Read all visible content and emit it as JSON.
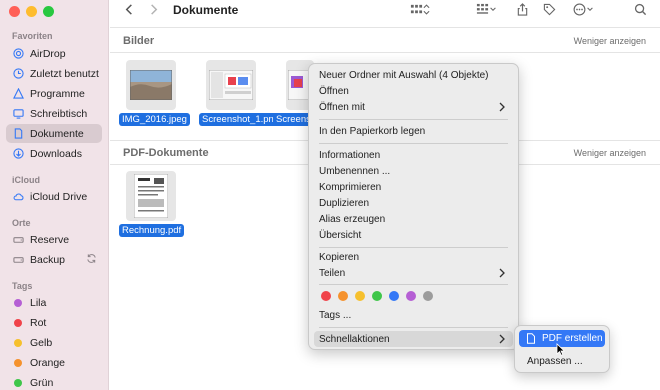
{
  "sidebar": {
    "favorites_heading": "Favoriten",
    "favorites": [
      {
        "label": "AirDrop",
        "icon": "airdrop-icon"
      },
      {
        "label": "Zuletzt benutzt",
        "icon": "clock-icon"
      },
      {
        "label": "Programme",
        "icon": "apps-icon"
      },
      {
        "label": "Schreibtisch",
        "icon": "desktop-icon"
      },
      {
        "label": "Dokumente",
        "icon": "document-icon",
        "active": true
      },
      {
        "label": "Downloads",
        "icon": "download-icon"
      }
    ],
    "icloud_heading": "iCloud",
    "icloud": [
      {
        "label": "iCloud Drive",
        "icon": "cloud-icon"
      }
    ],
    "places_heading": "Orte",
    "places": [
      {
        "label": "Reserve",
        "icon": "drive-icon"
      },
      {
        "label": "Backup",
        "icon": "drive-icon"
      }
    ],
    "tags_heading": "Tags",
    "tags": [
      {
        "label": "Lila",
        "color": "#b55fd4"
      },
      {
        "label": "Rot",
        "color": "#f0434a"
      },
      {
        "label": "Gelb",
        "color": "#f6c02d"
      },
      {
        "label": "Orange",
        "color": "#f5922d"
      },
      {
        "label": "Grün",
        "color": "#3fc64a"
      }
    ]
  },
  "toolbar": {
    "title": "Dokumente"
  },
  "groups": {
    "images": {
      "title": "Bilder",
      "action": "Weniger anzeigen",
      "files": [
        "IMG_2016.jpeg",
        "Screenshot_1.png",
        "Screens"
      ]
    },
    "pdf": {
      "title": "PDF-Dokumente",
      "action": "Weniger anzeigen",
      "files": [
        "Rechnung.pdf"
      ]
    }
  },
  "context_menu": {
    "items": [
      "Neuer Ordner mit Auswahl (4 Objekte)",
      "Öffnen",
      "Öffnen mit",
      "In den Papierkorb legen",
      "Informationen",
      "Umbenennen ...",
      "Komprimieren",
      "Duplizieren",
      "Alias erzeugen",
      "Übersicht",
      "Kopieren",
      "Teilen",
      "Tags ...",
      "Schnellaktionen"
    ],
    "tag_colors": [
      "#f0434a",
      "#f5922d",
      "#f6c02d",
      "#3fc64a",
      "#3478f6",
      "#b55fd4",
      "#9c9c9c"
    ]
  },
  "submenu": {
    "selected": "PDF erstellen",
    "other": "Anpassen ..."
  }
}
